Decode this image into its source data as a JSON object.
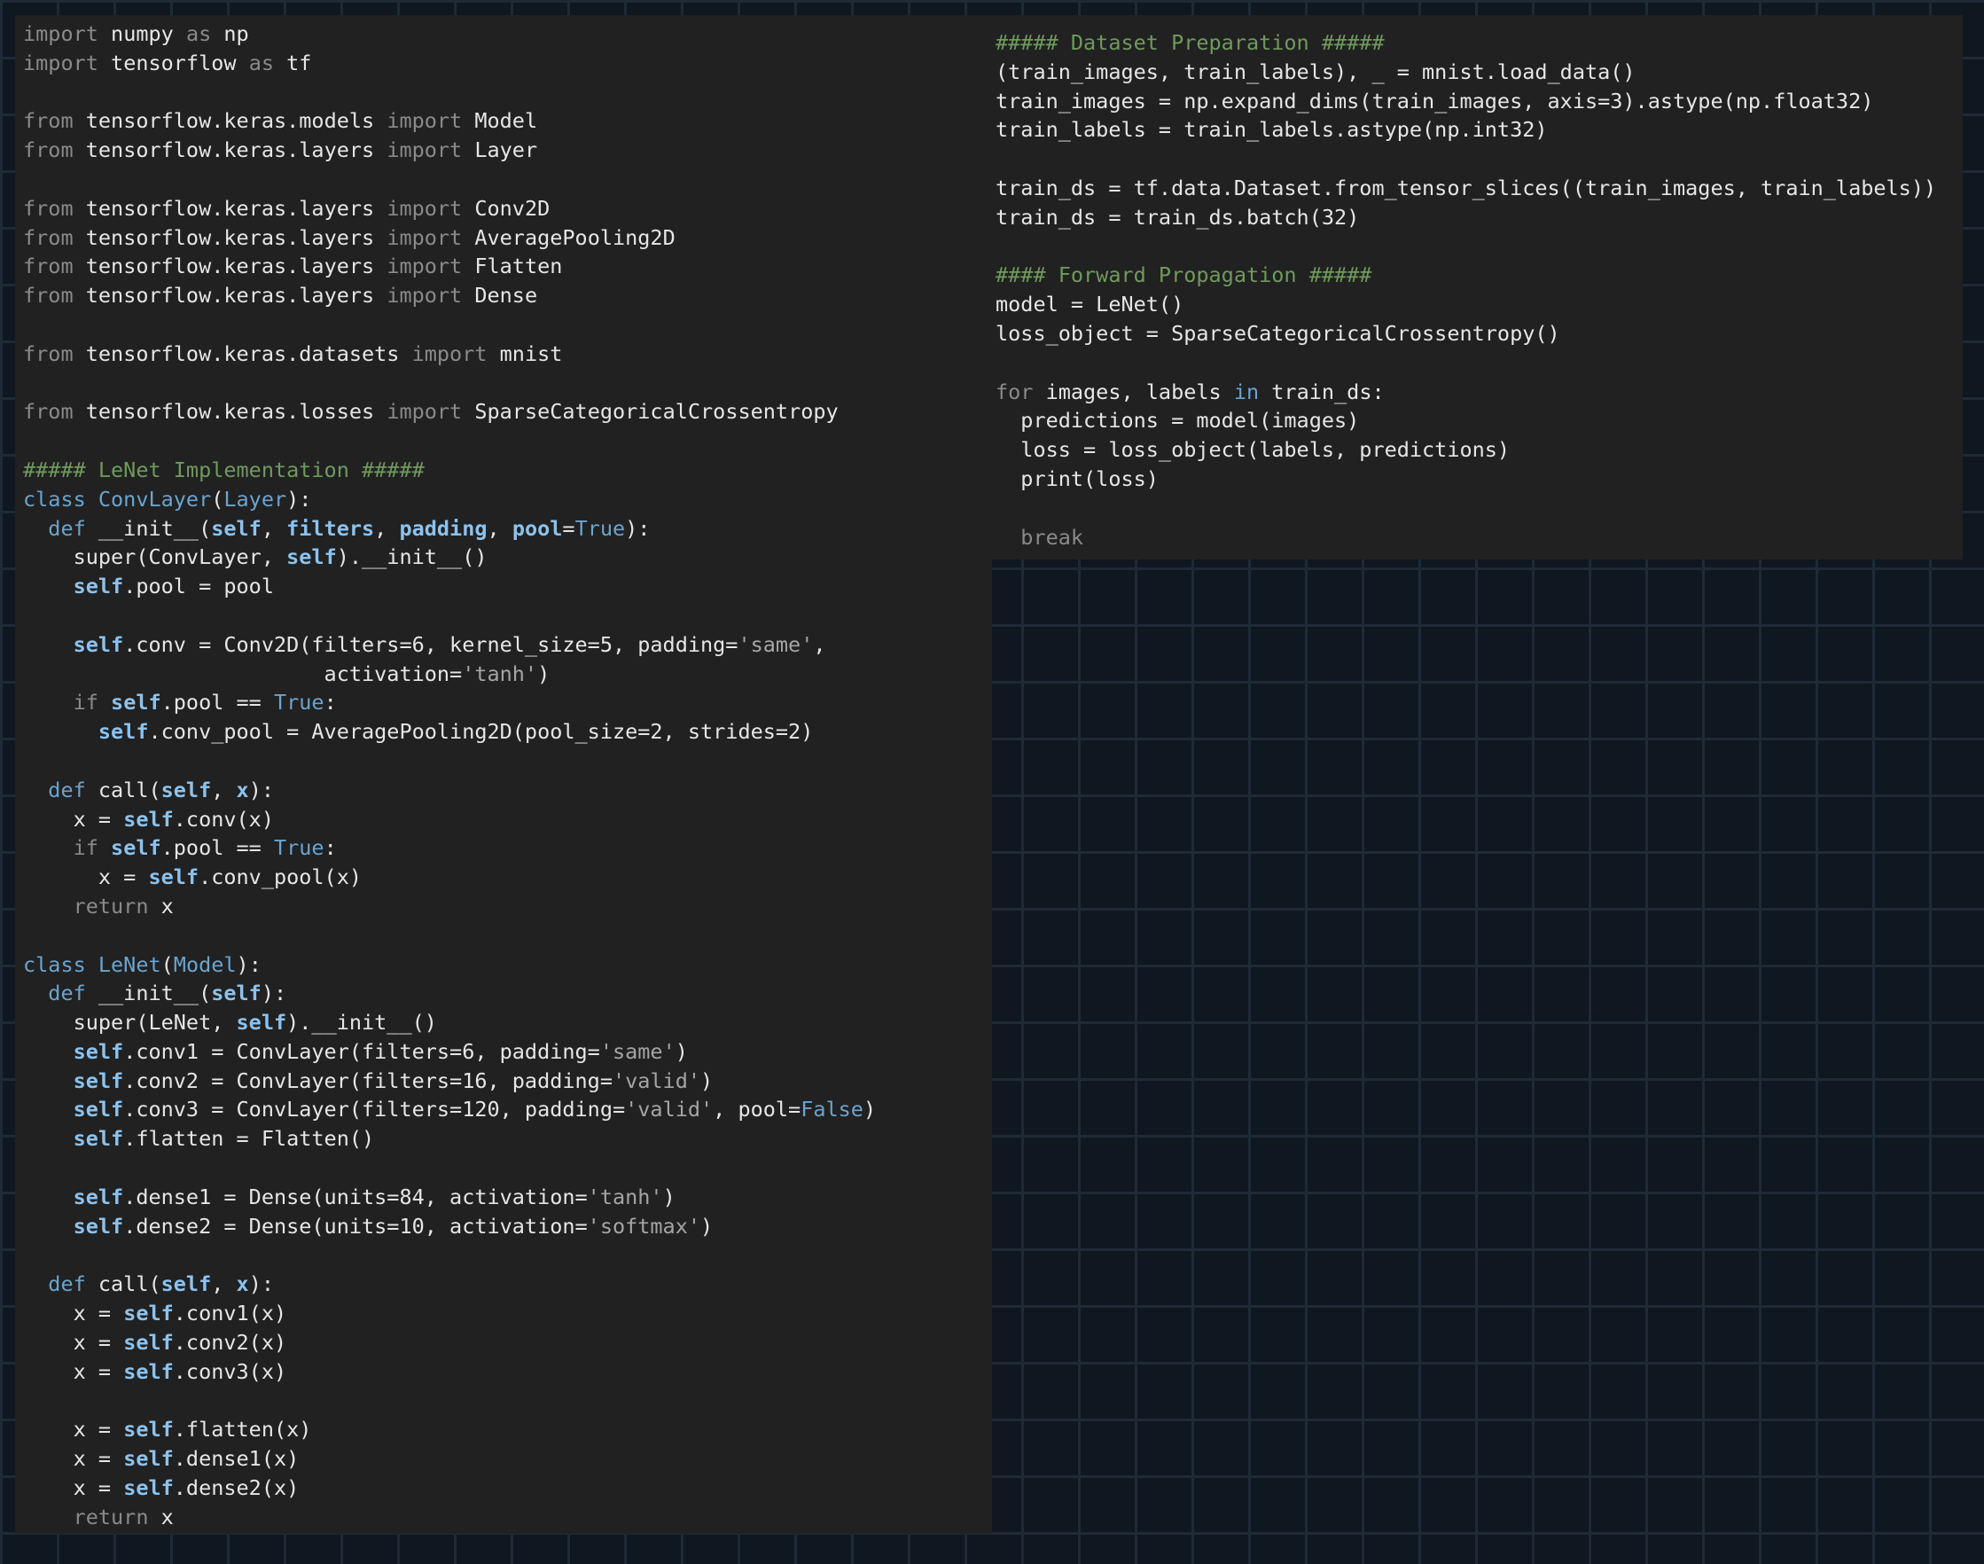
{
  "left_code": [
    [
      [
        "kw",
        "import "
      ],
      [
        "id",
        "numpy "
      ],
      [
        "kw",
        "as "
      ],
      [
        "id",
        "np"
      ]
    ],
    [
      [
        "kw",
        "import "
      ],
      [
        "id",
        "tensorflow "
      ],
      [
        "kw",
        "as "
      ],
      [
        "id",
        "tf"
      ]
    ],
    [],
    [
      [
        "kw",
        "from "
      ],
      [
        "id",
        "tensorflow.keras.models "
      ],
      [
        "kw",
        "import "
      ],
      [
        "id",
        "Model"
      ]
    ],
    [
      [
        "kw",
        "from "
      ],
      [
        "id",
        "tensorflow.keras.layers "
      ],
      [
        "kw",
        "import "
      ],
      [
        "id",
        "Layer"
      ]
    ],
    [],
    [
      [
        "kw",
        "from "
      ],
      [
        "id",
        "tensorflow.keras.layers "
      ],
      [
        "kw",
        "import "
      ],
      [
        "id",
        "Conv2D"
      ]
    ],
    [
      [
        "kw",
        "from "
      ],
      [
        "id",
        "tensorflow.keras.layers "
      ],
      [
        "kw",
        "import "
      ],
      [
        "id",
        "AveragePooling2D"
      ]
    ],
    [
      [
        "kw",
        "from "
      ],
      [
        "id",
        "tensorflow.keras.layers "
      ],
      [
        "kw",
        "import "
      ],
      [
        "id",
        "Flatten"
      ]
    ],
    [
      [
        "kw",
        "from "
      ],
      [
        "id",
        "tensorflow.keras.layers "
      ],
      [
        "kw",
        "import "
      ],
      [
        "id",
        "Dense"
      ]
    ],
    [],
    [
      [
        "kw",
        "from "
      ],
      [
        "id",
        "tensorflow.keras.datasets "
      ],
      [
        "kw",
        "import "
      ],
      [
        "id",
        "mnist"
      ]
    ],
    [],
    [
      [
        "kw",
        "from "
      ],
      [
        "id",
        "tensorflow.keras.losses "
      ],
      [
        "kw",
        "import "
      ],
      [
        "id",
        "SparseCategoricalCrossentropy"
      ]
    ],
    [],
    [
      [
        "cm",
        "##### LeNet Implementation #####"
      ]
    ],
    [
      [
        "kwb",
        "class "
      ],
      [
        "kwb",
        "ConvLayer"
      ],
      [
        "id",
        "("
      ],
      [
        "kwb",
        "Layer"
      ],
      [
        "id",
        "):"
      ]
    ],
    [
      [
        "id",
        "  "
      ],
      [
        "kwb",
        "def "
      ],
      [
        "id",
        "__init__("
      ],
      [
        "self",
        "self"
      ],
      [
        "id",
        ", "
      ],
      [
        "param",
        "filters"
      ],
      [
        "id",
        ", "
      ],
      [
        "param",
        "padding"
      ],
      [
        "id",
        ", "
      ],
      [
        "param",
        "pool"
      ],
      [
        "id",
        "="
      ],
      [
        "bool",
        "True"
      ],
      [
        "id",
        "):"
      ]
    ],
    [
      [
        "id",
        "    super(ConvLayer, "
      ],
      [
        "self",
        "self"
      ],
      [
        "id",
        ").__init__()"
      ]
    ],
    [
      [
        "id",
        "    "
      ],
      [
        "self",
        "self"
      ],
      [
        "id",
        ".pool = pool"
      ]
    ],
    [],
    [
      [
        "id",
        "    "
      ],
      [
        "self",
        "self"
      ],
      [
        "id",
        ".conv = Conv2D(filters=6, kernel_size=5, padding="
      ],
      [
        "str",
        "'same'"
      ],
      [
        "id",
        ","
      ]
    ],
    [
      [
        "id",
        "                        activation="
      ],
      [
        "str",
        "'tanh'"
      ],
      [
        "id",
        ")"
      ]
    ],
    [
      [
        "id",
        "    "
      ],
      [
        "kw",
        "if "
      ],
      [
        "self",
        "self"
      ],
      [
        "id",
        ".pool == "
      ],
      [
        "bool",
        "True"
      ],
      [
        "id",
        ":"
      ]
    ],
    [
      [
        "id",
        "      "
      ],
      [
        "self",
        "self"
      ],
      [
        "id",
        ".conv_pool = AveragePooling2D(pool_size=2, strides=2)"
      ]
    ],
    [],
    [
      [
        "id",
        "  "
      ],
      [
        "kwb",
        "def "
      ],
      [
        "id",
        "call("
      ],
      [
        "self",
        "self"
      ],
      [
        "id",
        ", "
      ],
      [
        "param",
        "x"
      ],
      [
        "id",
        "):"
      ]
    ],
    [
      [
        "id",
        "    x = "
      ],
      [
        "self",
        "self"
      ],
      [
        "id",
        ".conv(x)"
      ]
    ],
    [
      [
        "id",
        "    "
      ],
      [
        "kw",
        "if "
      ],
      [
        "self",
        "self"
      ],
      [
        "id",
        ".pool == "
      ],
      [
        "bool",
        "True"
      ],
      [
        "id",
        ":"
      ]
    ],
    [
      [
        "id",
        "      x = "
      ],
      [
        "self",
        "self"
      ],
      [
        "id",
        ".conv_pool(x)"
      ]
    ],
    [
      [
        "id",
        "    "
      ],
      [
        "kw",
        "return "
      ],
      [
        "id",
        "x"
      ]
    ],
    [],
    [
      [
        "kwb",
        "class "
      ],
      [
        "kwb",
        "LeNet"
      ],
      [
        "id",
        "("
      ],
      [
        "kwb",
        "Model"
      ],
      [
        "id",
        "):"
      ]
    ],
    [
      [
        "id",
        "  "
      ],
      [
        "kwb",
        "def "
      ],
      [
        "id",
        "__init__("
      ],
      [
        "self",
        "self"
      ],
      [
        "id",
        "):"
      ]
    ],
    [
      [
        "id",
        "    super(LeNet, "
      ],
      [
        "self",
        "self"
      ],
      [
        "id",
        ").__init__()"
      ]
    ],
    [
      [
        "id",
        "    "
      ],
      [
        "self",
        "self"
      ],
      [
        "id",
        ".conv1 = ConvLayer(filters=6, padding="
      ],
      [
        "str",
        "'same'"
      ],
      [
        "id",
        ")"
      ]
    ],
    [
      [
        "id",
        "    "
      ],
      [
        "self",
        "self"
      ],
      [
        "id",
        ".conv2 = ConvLayer(filters=16, padding="
      ],
      [
        "str",
        "'valid'"
      ],
      [
        "id",
        ")"
      ]
    ],
    [
      [
        "id",
        "    "
      ],
      [
        "self",
        "self"
      ],
      [
        "id",
        ".conv3 = ConvLayer(filters=120, padding="
      ],
      [
        "str",
        "'valid'"
      ],
      [
        "id",
        ", pool="
      ],
      [
        "bool",
        "False"
      ],
      [
        "id",
        ")"
      ]
    ],
    [
      [
        "id",
        "    "
      ],
      [
        "self",
        "self"
      ],
      [
        "id",
        ".flatten = Flatten()"
      ]
    ],
    [],
    [
      [
        "id",
        "    "
      ],
      [
        "self",
        "self"
      ],
      [
        "id",
        ".dense1 = Dense(units=84, activation="
      ],
      [
        "str",
        "'tanh'"
      ],
      [
        "id",
        ")"
      ]
    ],
    [
      [
        "id",
        "    "
      ],
      [
        "self",
        "self"
      ],
      [
        "id",
        ".dense2 = Dense(units=10, activation="
      ],
      [
        "str",
        "'softmax'"
      ],
      [
        "id",
        ")"
      ]
    ],
    [],
    [
      [
        "id",
        "  "
      ],
      [
        "kwb",
        "def "
      ],
      [
        "id",
        "call("
      ],
      [
        "self",
        "self"
      ],
      [
        "id",
        ", "
      ],
      [
        "param",
        "x"
      ],
      [
        "id",
        "):"
      ]
    ],
    [
      [
        "id",
        "    x = "
      ],
      [
        "self",
        "self"
      ],
      [
        "id",
        ".conv1(x)"
      ]
    ],
    [
      [
        "id",
        "    x = "
      ],
      [
        "self",
        "self"
      ],
      [
        "id",
        ".conv2(x)"
      ]
    ],
    [
      [
        "id",
        "    x = "
      ],
      [
        "self",
        "self"
      ],
      [
        "id",
        ".conv3(x)"
      ]
    ],
    [],
    [
      [
        "id",
        "    x = "
      ],
      [
        "self",
        "self"
      ],
      [
        "id",
        ".flatten(x)"
      ]
    ],
    [
      [
        "id",
        "    x = "
      ],
      [
        "self",
        "self"
      ],
      [
        "id",
        ".dense1(x)"
      ]
    ],
    [
      [
        "id",
        "    x = "
      ],
      [
        "self",
        "self"
      ],
      [
        "id",
        ".dense2(x)"
      ]
    ],
    [
      [
        "id",
        "    "
      ],
      [
        "kw",
        "return "
      ],
      [
        "id",
        "x"
      ]
    ]
  ],
  "right_code": [
    [
      [
        "cm",
        "##### Dataset Preparation #####"
      ]
    ],
    [
      [
        "id",
        "(train_images, train_labels), _ = mnist.load_data()"
      ]
    ],
    [
      [
        "id",
        "train_images = np.expand_dims(train_images, axis=3).astype(np.float32)"
      ]
    ],
    [
      [
        "id",
        "train_labels = train_labels.astype(np.int32)"
      ]
    ],
    [],
    [
      [
        "id",
        "train_ds = tf.data.Dataset.from_tensor_slices((train_images, train_labels))"
      ]
    ],
    [
      [
        "id",
        "train_ds = train_ds.batch(32)"
      ]
    ],
    [],
    [
      [
        "cm",
        "#### Forward Propagation #####"
      ]
    ],
    [
      [
        "id",
        "model = LeNet()"
      ]
    ],
    [
      [
        "id",
        "loss_object = SparseCategoricalCrossentropy()"
      ]
    ],
    [],
    [
      [
        "kw",
        "for "
      ],
      [
        "id",
        "images, labels "
      ],
      [
        "kwb",
        "in "
      ],
      [
        "id",
        "train_ds:"
      ]
    ],
    [
      [
        "id",
        "  predictions = model(images)"
      ]
    ],
    [
      [
        "id",
        "  loss = loss_object(labels, predictions)"
      ]
    ],
    [
      [
        "id",
        "  print(loss)"
      ]
    ],
    [],
    [
      [
        "id",
        "  "
      ],
      [
        "kw",
        "break"
      ]
    ]
  ]
}
